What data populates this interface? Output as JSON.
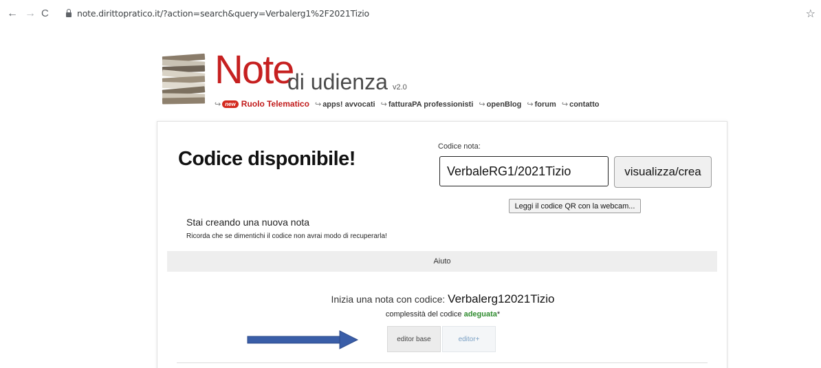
{
  "browser": {
    "url": "note.dirittopratico.it/?action=search&query=Verbalerg1%2F2021Tizio"
  },
  "header": {
    "logo_title": "Note",
    "logo_subtitle": "di udienza",
    "version": "v2.0",
    "new_badge": "new",
    "nav": [
      "Ruolo Telematico",
      "apps! avvocati",
      "fatturaPA professionisti",
      "openBlog",
      "forum",
      "contatto"
    ]
  },
  "main": {
    "title": "Codice disponibile!",
    "code_label": "Codice nota:",
    "code_value": "VerbaleRG1/2021Tizio",
    "view_button": "visualizza/crea",
    "qr_button": "Leggi il codice QR con la webcam...",
    "creating_text": "Stai creando una nuova nota",
    "remember_text": "Ricorda che se dimentichi il codice non avrai modo di recuperarla!",
    "help_label": "Aiuto",
    "start_prefix": "Inizia una nota con codice:",
    "start_code": "Verbalerg12021Tizio",
    "complexity_prefix": "complessità del codice",
    "complexity_value": "adeguata",
    "complexity_suffix": "*",
    "editor_base": "editor base",
    "editor_plus": "editor+"
  },
  "colors": {
    "brand_red": "#c62020",
    "complexity_green": "#2e8b2e",
    "annotation_blue": "#3a5ea8"
  }
}
